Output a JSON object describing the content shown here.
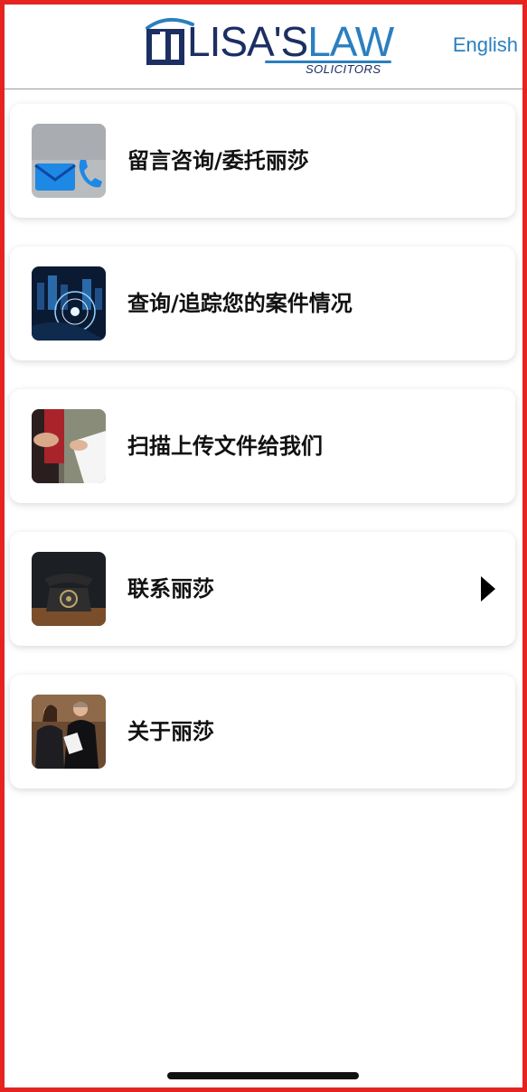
{
  "header": {
    "logo": {
      "brand": "LISA'S",
      "law": "LAW",
      "sub": "SOLICITORS"
    },
    "language_link": "English"
  },
  "menu": [
    {
      "label": "留言咨询/委托丽莎",
      "icon": "message-phone-icon",
      "has_arrow": false
    },
    {
      "label": "查询/追踪您的案件情况",
      "icon": "network-city-icon",
      "has_arrow": false
    },
    {
      "label": "扫描上传文件给我们",
      "icon": "document-handover-icon",
      "has_arrow": false
    },
    {
      "label": "联系丽莎",
      "icon": "telephone-icon",
      "has_arrow": true
    },
    {
      "label": "关于丽莎",
      "icon": "lawyers-icon",
      "has_arrow": false
    }
  ],
  "colors": {
    "brand_dark": "#1c2f63",
    "brand_blue": "#2b7fbf",
    "border": "#e52421"
  }
}
